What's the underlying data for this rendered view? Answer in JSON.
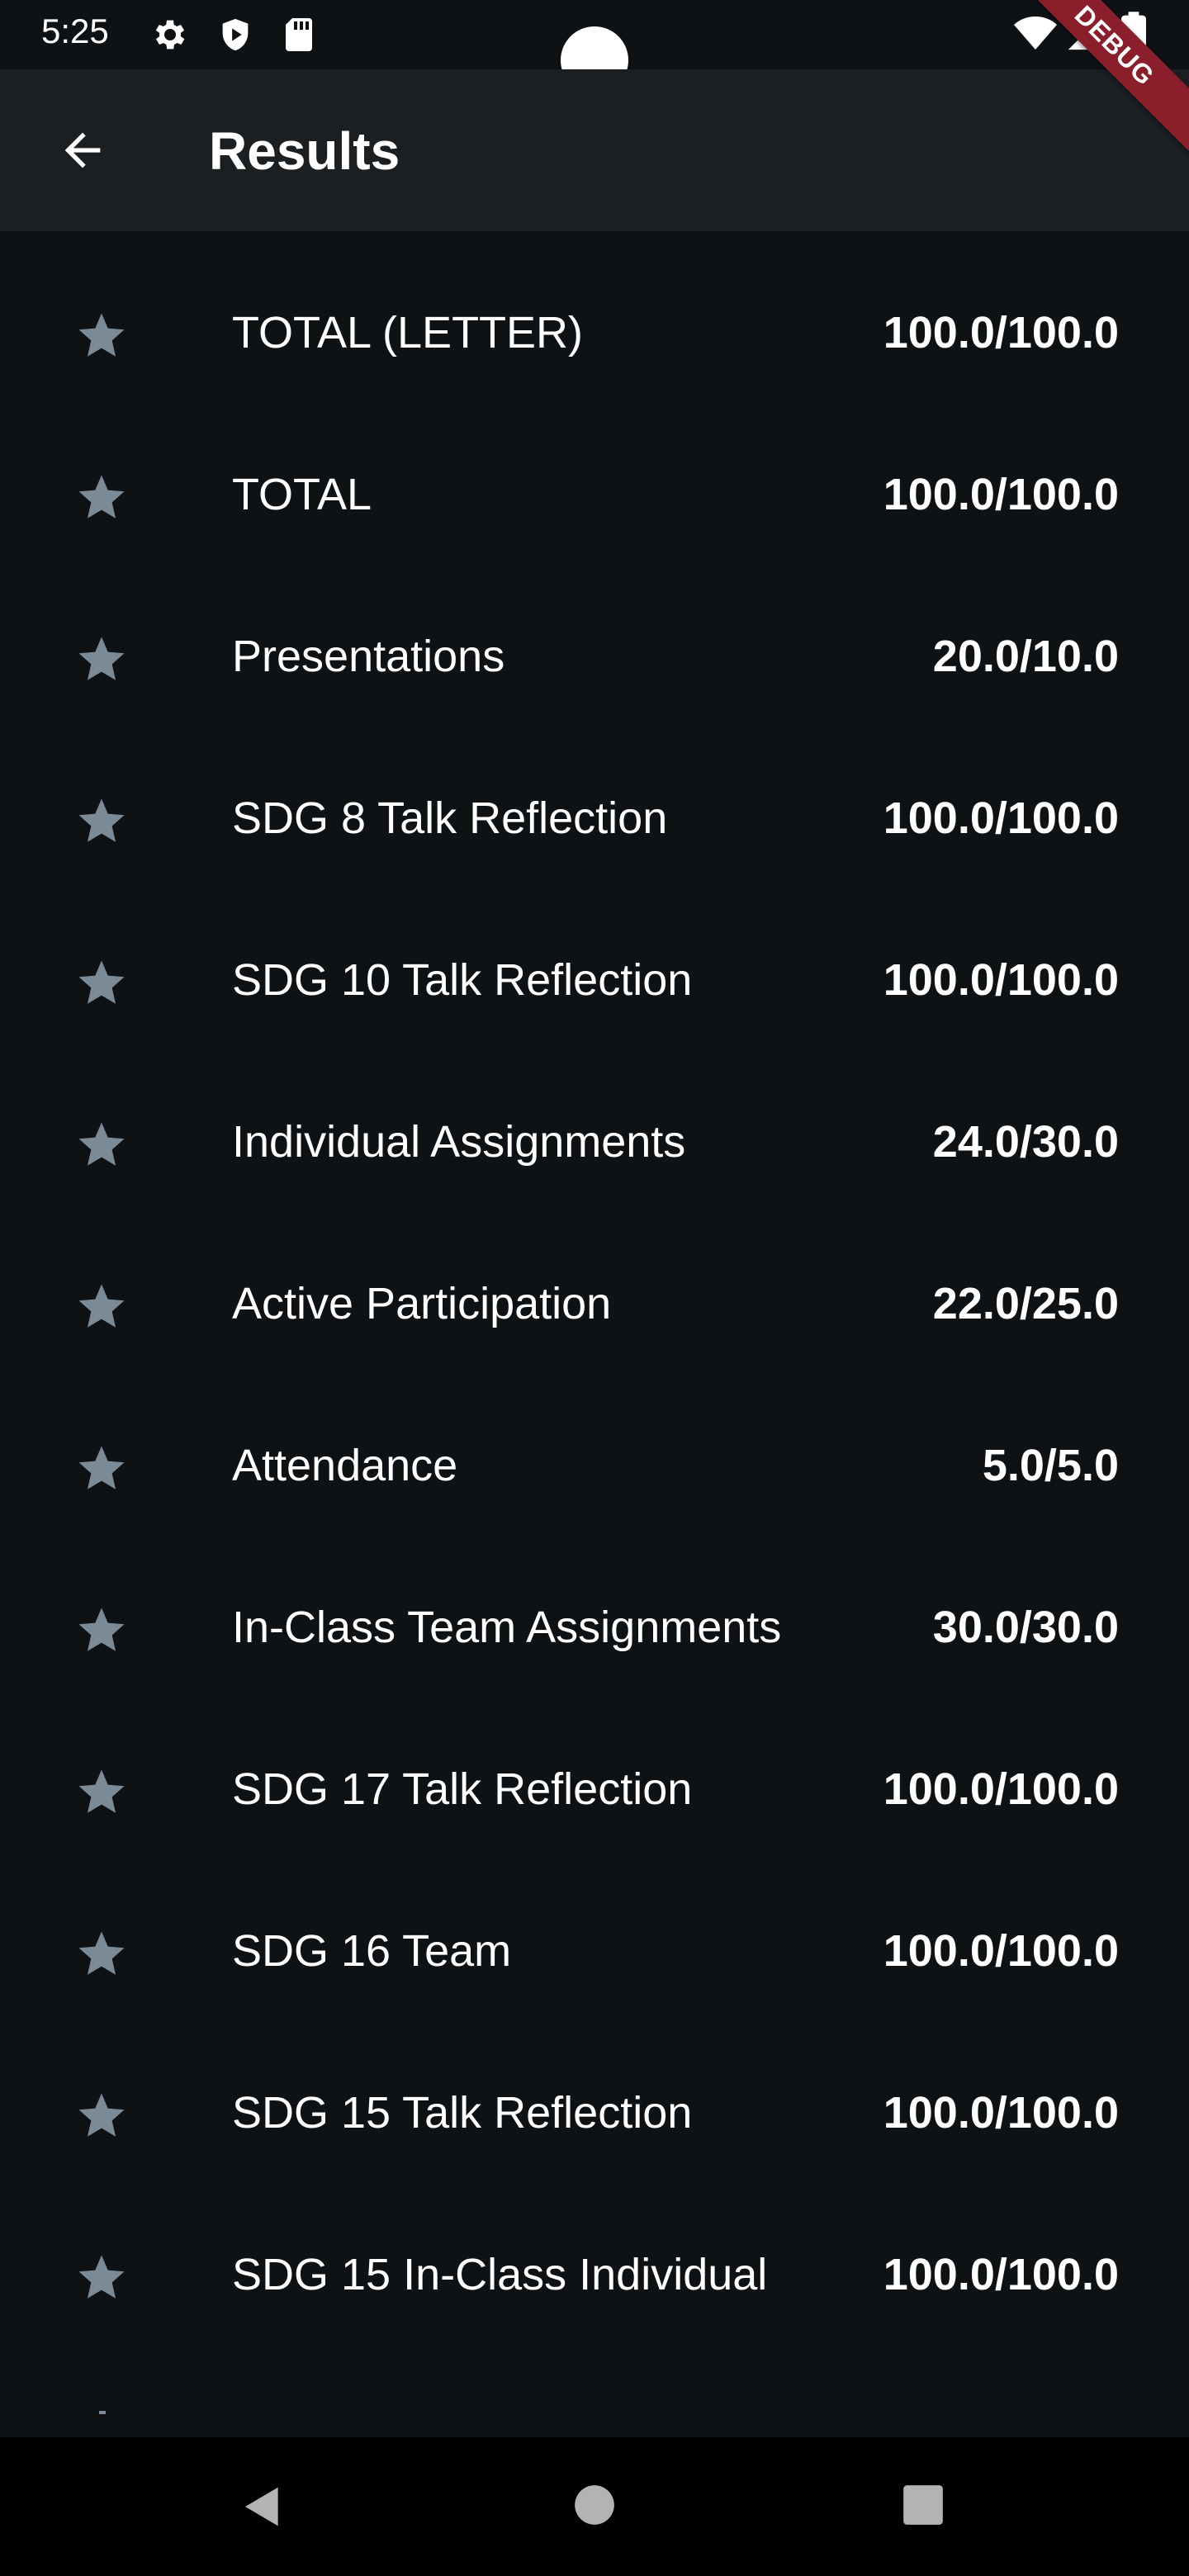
{
  "status_bar": {
    "time": "5:25",
    "icons": [
      "settings-gear-icon",
      "shield-play-icon",
      "sd-card-icon",
      "wifi-icon",
      "cellular-signal-icon",
      "battery-icon"
    ]
  },
  "debug_banner": "DEBUG",
  "app_bar": {
    "title": "Results",
    "back_icon": "arrow-back-icon"
  },
  "results": [
    {
      "name": "TOTAL (LETTER)",
      "score": "100.0/100.0"
    },
    {
      "name": "TOTAL",
      "score": "100.0/100.0"
    },
    {
      "name": "Presentations",
      "score": "20.0/10.0"
    },
    {
      "name": "SDG 8 Talk Reflection",
      "score": "100.0/100.0"
    },
    {
      "name": "SDG 10 Talk Reflection",
      "score": "100.0/100.0"
    },
    {
      "name": "Individual Assignments",
      "score": "24.0/30.0"
    },
    {
      "name": "Active Participation",
      "score": "22.0/25.0"
    },
    {
      "name": "Attendance",
      "score": "5.0/5.0"
    },
    {
      "name": "In-Class Team Assignments",
      "score": "30.0/30.0"
    },
    {
      "name": "SDG 17 Talk Reflection",
      "score": "100.0/100.0"
    },
    {
      "name": "SDG 16 Team",
      "score": "100.0/100.0"
    },
    {
      "name": "SDG 15 Talk Reflection",
      "score": "100.0/100.0"
    },
    {
      "name": "SDG 15 In-Class Individual",
      "score": "100.0/100.0"
    }
  ],
  "colors": {
    "background": "#0f1215",
    "app_bar": "#1b1f22",
    "star": "#7a8a96",
    "debug_ribbon": "#8a1e2b",
    "text": "#ffffff"
  },
  "nav_bar": {
    "icons": [
      "nav-back-triangle-icon",
      "nav-home-circle-icon",
      "nav-recents-square-icon"
    ]
  }
}
